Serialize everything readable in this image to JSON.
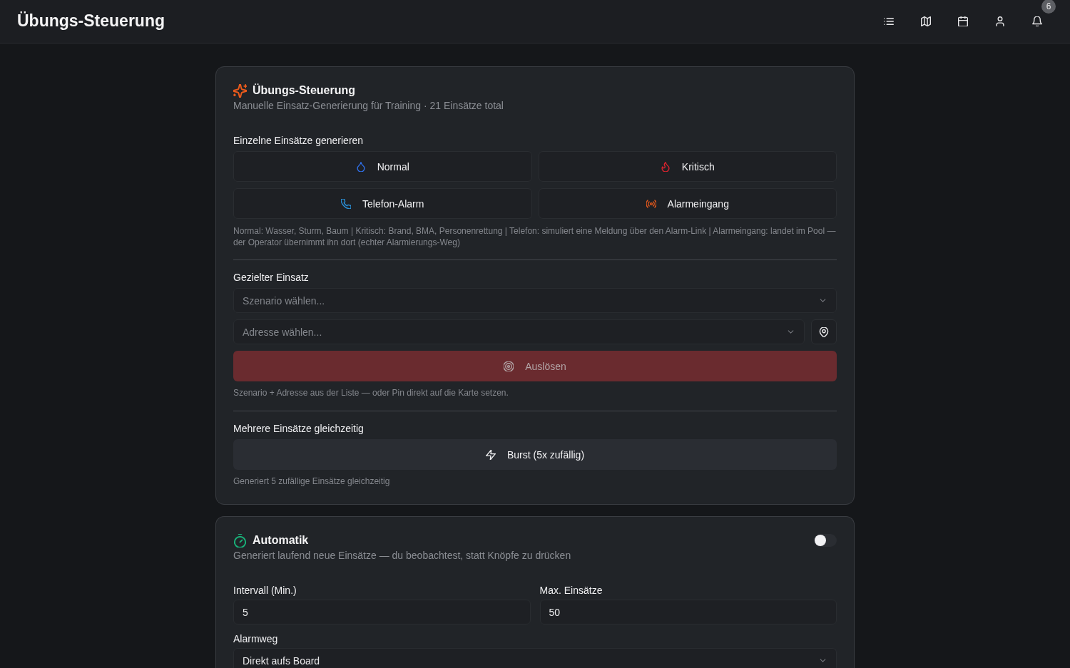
{
  "header": {
    "title": "Übungs-Steuerung",
    "notification_count": "6"
  },
  "exercise_card": {
    "title": "Übungs-Steuerung",
    "subtitle": "Manuelle Einsatz-Generierung für Training · 21 Einsätze total",
    "single": {
      "label": "Einzelne Einsätze generieren",
      "buttons": [
        {
          "label": "Normal",
          "kind": "droplet"
        },
        {
          "label": "Kritisch",
          "kind": "flame"
        },
        {
          "label": "Telefon-Alarm",
          "kind": "phone"
        },
        {
          "label": "Alarmeingang",
          "kind": "broadcast"
        }
      ],
      "hint": "Normal: Wasser, Sturm, Baum | Kritisch: Brand, BMA, Personenrettung | Telefon: simuliert eine Meldung über den Alarm-Link | Alarmeingang: landet im Pool — der Operator übernimmt ihn dort (echter Alarmierungs-Weg)"
    },
    "targeted": {
      "label": "Gezielter Einsatz",
      "scenario": {
        "placeholder": "Szenario wählen..."
      },
      "address": {
        "placeholder": "Adresse wählen..."
      },
      "trigger": {
        "label": "Auslösen",
        "disabled": true
      },
      "hint": "Szenario + Adresse aus der Liste — oder Pin direkt auf die Karte setzen."
    },
    "burst": {
      "label": "Mehrere Einsätze gleichzeitig",
      "button": "Burst (5x zufällig)",
      "hint": "Generiert 5 zufällige Einsätze gleichzeitig"
    }
  },
  "automatik": {
    "title": "Automatik",
    "subtitle": "Generiert laufend neue Einsätze — du beobachtest, statt Knöpfe zu drücken",
    "on": false,
    "fields": [
      {
        "label": "Intervall (Min.)",
        "value": "5"
      },
      {
        "label": "Max. Einsätze",
        "value": "50"
      }
    ],
    "route": {
      "label": "Alarmweg",
      "value": "Direkt aufs Board"
    }
  }
}
